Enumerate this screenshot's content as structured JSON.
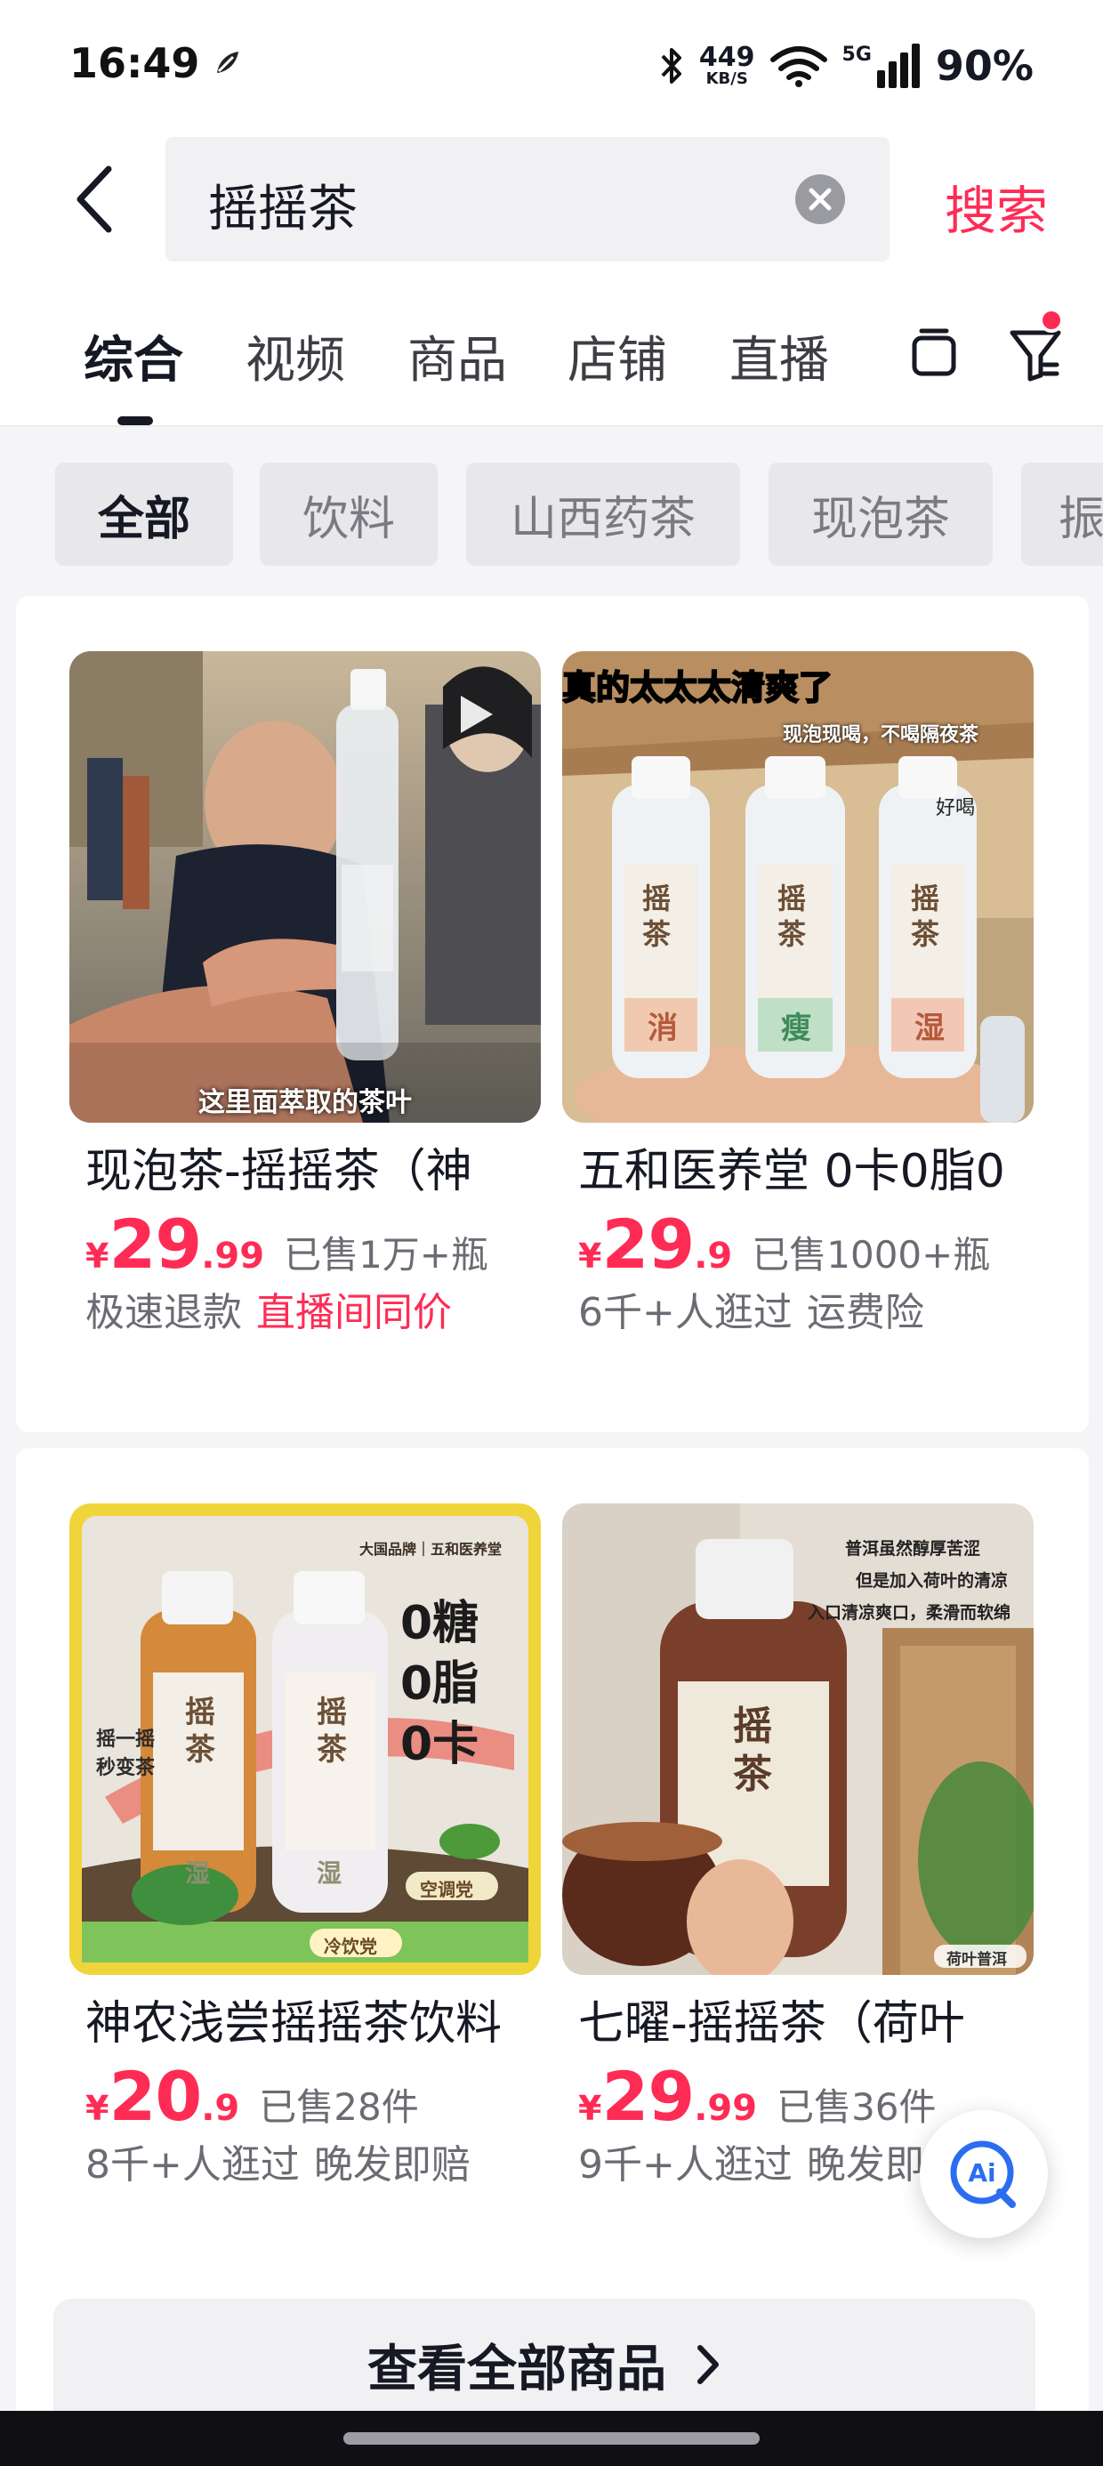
{
  "status_bar": {
    "time": "16:49",
    "net_speed_value": "449",
    "net_speed_unit": "KB/S",
    "network_type": "5G",
    "battery": "90%"
  },
  "search": {
    "query": "摇摇茶",
    "submit_label": "搜索"
  },
  "tabs": [
    {
      "label": "综合",
      "active": true
    },
    {
      "label": "视频"
    },
    {
      "label": "商品"
    },
    {
      "label": "店铺"
    },
    {
      "label": "直播"
    }
  ],
  "chips": [
    {
      "label": "全部",
      "active": true
    },
    {
      "label": "饮料"
    },
    {
      "label": "山西药茶"
    },
    {
      "label": "现泡茶"
    },
    {
      "label": "振"
    }
  ],
  "products": [
    {
      "name": "现泡茶-摇摇茶（神",
      "currency": "¥",
      "price_int": "29",
      "price_dec": ".99",
      "sold": "已售1万+瓶",
      "tags": [
        "极速退款",
        "直播间同价"
      ],
      "image_caption": "这里面萃取的茶叶"
    },
    {
      "name": "五和医养堂 0卡0脂0",
      "currency": "¥",
      "price_int": "29",
      "price_dec": ".9",
      "sold": "已售1000+瓶",
      "tags": [
        "6千+人逛过",
        "运费险"
      ],
      "image_headline": "真的太太太清爽了",
      "image_sub": "现泡现喝，不喝隔夜茶",
      "image_note": "好喝",
      "bottle_brand": "摇茶",
      "bottle_labels": [
        "消",
        "瘦",
        "湿"
      ]
    },
    {
      "name": "神农浅尝摇摇茶饮料",
      "currency": "¥",
      "price_int": "20",
      "price_dec": ".9",
      "sold": "已售28件",
      "tags": [
        "8千+人逛过",
        "晚发即赔"
      ],
      "image_brand": "大国品牌｜五和医养堂",
      "image_claims": [
        "0糖",
        "0脂",
        "0卡"
      ],
      "image_side": "摇一摇 秒变茶",
      "image_badge_left": "冷饮党",
      "image_badge_right": "空调党",
      "bottle_brand": "摇茶",
      "bottle_labels": [
        "湿",
        "湿"
      ]
    },
    {
      "name": "七曜-摇摇茶（荷叶",
      "currency": "¥",
      "price_int": "29",
      "price_dec": ".99",
      "sold": "已售36件",
      "tags": [
        "9千+人逛过",
        "晚发即"
      ],
      "image_text_lines": [
        "普洱虽然醇厚苦涩",
        "但是加入荷叶的清凉",
        "入口清凉爽口，柔滑而软绵"
      ],
      "image_location": "荷叶普洱",
      "bottle_brand": "摇茶"
    }
  ],
  "see_all_label": "查看全部商品",
  "ai_button_label": "Ai",
  "colors": {
    "accent": "#fe2c55",
    "text_primary": "#161823",
    "text_secondary": "#6b6c73",
    "page_bg": "#f5f5f7"
  }
}
